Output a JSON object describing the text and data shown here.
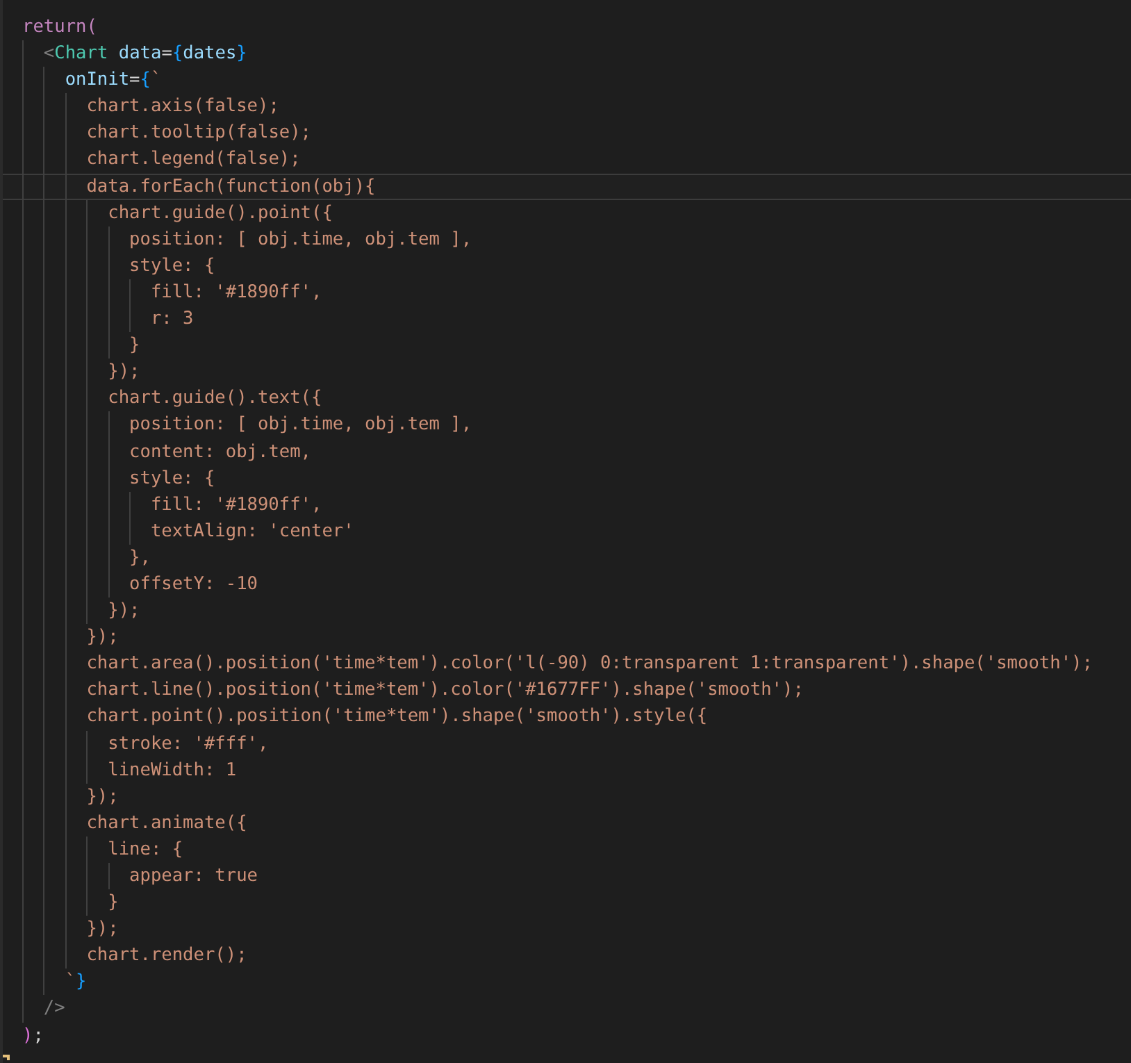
{
  "editor": {
    "lines": [
      {
        "current": false,
        "tokens": [
          {
            "kind": "keyword",
            "text": "return"
          },
          {
            "kind": "keyword",
            "text": "("
          }
        ],
        "children": [
          {
            "current": false,
            "tokens": [
              {
                "kind": "punct",
                "text": "<"
              },
              {
                "kind": "tag",
                "text": "Chart"
              },
              {
                "kind": "attr",
                "text": "data"
              },
              {
                "kind": "plain",
                "text": "="
              },
              {
                "kind": "brace",
                "text": "{"
              },
              {
                "kind": "attr",
                "text": "dates"
              },
              {
                "kind": "brace",
                "text": "}"
              }
            ],
            "children": [
              {
                "current": false,
                "tokens": [
                  {
                    "kind": "attr",
                    "text": "onInit"
                  },
                  {
                    "kind": "plain",
                    "text": "="
                  },
                  {
                    "kind": "brace",
                    "text": "{"
                  },
                  {
                    "kind": "string",
                    "text": "`"
                  }
                ],
                "children": [
                  {
                    "current": false,
                    "tokens": [
                      {
                        "kind": "string",
                        "text": "chart.axis(false);"
                      }
                    ]
                  },
                  {
                    "current": false,
                    "tokens": [
                      {
                        "kind": "string",
                        "text": "chart.tooltip(false);"
                      }
                    ]
                  },
                  {
                    "current": false,
                    "tokens": [
                      {
                        "kind": "string",
                        "text": "chart.legend(false);"
                      }
                    ]
                  },
                  {
                    "current": true,
                    "tokens": [
                      {
                        "kind": "string",
                        "text": "data.forEach(function(obj){"
                      }
                    ],
                    "children": [
                      {
                        "current": false,
                        "tokens": [
                          {
                            "kind": "string",
                            "text": "chart.guide().point({"
                          }
                        ],
                        "children": [
                          {
                            "current": false,
                            "tokens": [
                              {
                                "kind": "string",
                                "text": "position: [ obj.time, obj.tem ],"
                              }
                            ]
                          },
                          {
                            "current": false,
                            "tokens": [
                              {
                                "kind": "string",
                                "text": "style: {"
                              }
                            ],
                            "children": [
                              {
                                "current": false,
                                "tokens": [
                                  {
                                    "kind": "string",
                                    "text": "fill: '#1890ff',"
                                  }
                                ]
                              },
                              {
                                "current": false,
                                "tokens": [
                                  {
                                    "kind": "string",
                                    "text": "r: 3"
                                  }
                                ]
                              }
                            ]
                          },
                          {
                            "current": false,
                            "tokens": [
                              {
                                "kind": "string",
                                "text": "}"
                              }
                            ]
                          }
                        ]
                      },
                      {
                        "current": false,
                        "tokens": [
                          {
                            "kind": "string",
                            "text": "});"
                          }
                        ]
                      },
                      {
                        "current": false,
                        "tokens": [
                          {
                            "kind": "string",
                            "text": "chart.guide().text({"
                          }
                        ],
                        "children": [
                          {
                            "current": false,
                            "tokens": [
                              {
                                "kind": "string",
                                "text": "position: [ obj.time, obj.tem ],"
                              }
                            ]
                          },
                          {
                            "current": false,
                            "tokens": [
                              {
                                "kind": "string",
                                "text": "content: obj.tem,"
                              }
                            ]
                          },
                          {
                            "current": false,
                            "tokens": [
                              {
                                "kind": "string",
                                "text": "style: {"
                              }
                            ],
                            "children": [
                              {
                                "current": false,
                                "tokens": [
                                  {
                                    "kind": "string",
                                    "text": "fill: '#1890ff',"
                                  }
                                ]
                              },
                              {
                                "current": false,
                                "tokens": [
                                  {
                                    "kind": "string",
                                    "text": "textAlign: 'center'"
                                  }
                                ]
                              }
                            ]
                          },
                          {
                            "current": false,
                            "tokens": [
                              {
                                "kind": "string",
                                "text": "},"
                              }
                            ]
                          },
                          {
                            "current": false,
                            "tokens": [
                              {
                                "kind": "string",
                                "text": "offsetY: -10"
                              }
                            ]
                          }
                        ]
                      },
                      {
                        "current": false,
                        "tokens": [
                          {
                            "kind": "string",
                            "text": "});"
                          }
                        ]
                      }
                    ]
                  },
                  {
                    "current": false,
                    "tokens": [
                      {
                        "kind": "string",
                        "text": "});"
                      }
                    ]
                  },
                  {
                    "current": false,
                    "tokens": [
                      {
                        "kind": "string",
                        "text": "chart.area().position('time*tem').color('l(-90) 0:transparent 1:transparent').shape('smooth');"
                      }
                    ]
                  },
                  {
                    "current": false,
                    "tokens": [
                      {
                        "kind": "string",
                        "text": "chart.line().position('time*tem').color('#1677FF').shape('smooth');"
                      }
                    ]
                  },
                  {
                    "current": false,
                    "tokens": [
                      {
                        "kind": "string",
                        "text": "chart.point().position('time*tem').shape('smooth').style({"
                      }
                    ],
                    "children": [
                      {
                        "current": false,
                        "tokens": [
                          {
                            "kind": "string",
                            "text": "stroke: '#fff',"
                          }
                        ]
                      },
                      {
                        "current": false,
                        "tokens": [
                          {
                            "kind": "string",
                            "text": "lineWidth: 1"
                          }
                        ]
                      }
                    ]
                  },
                  {
                    "current": false,
                    "tokens": [
                      {
                        "kind": "string",
                        "text": "});"
                      }
                    ]
                  },
                  {
                    "current": false,
                    "tokens": [
                      {
                        "kind": "string",
                        "text": "chart.animate({"
                      }
                    ],
                    "children": [
                      {
                        "current": false,
                        "tokens": [
                          {
                            "kind": "string",
                            "text": "line: {"
                          }
                        ],
                        "children": [
                          {
                            "current": false,
                            "tokens": [
                              {
                                "kind": "string",
                                "text": "appear: true"
                              }
                            ]
                          }
                        ]
                      },
                      {
                        "current": false,
                        "tokens": [
                          {
                            "kind": "string",
                            "text": "}"
                          }
                        ]
                      }
                    ]
                  },
                  {
                    "current": false,
                    "tokens": [
                      {
                        "kind": "string",
                        "text": "});"
                      }
                    ]
                  },
                  {
                    "current": false,
                    "tokens": [
                      {
                        "kind": "string",
                        "text": "chart.render();"
                      }
                    ]
                  }
                ]
              },
              {
                "current": false,
                "tokens": [
                  {
                    "kind": "string",
                    "text": "`"
                  },
                  {
                    "kind": "brace",
                    "text": "}"
                  }
                ]
              }
            ]
          },
          {
            "current": false,
            "tokens": [
              {
                "kind": "punct",
                "text": "/>"
              }
            ]
          }
        ]
      },
      {
        "current": false,
        "tokens": [
          {
            "kind": "paren",
            "text": ")"
          },
          {
            "kind": "plain",
            "text": ";"
          }
        ]
      }
    ]
  }
}
